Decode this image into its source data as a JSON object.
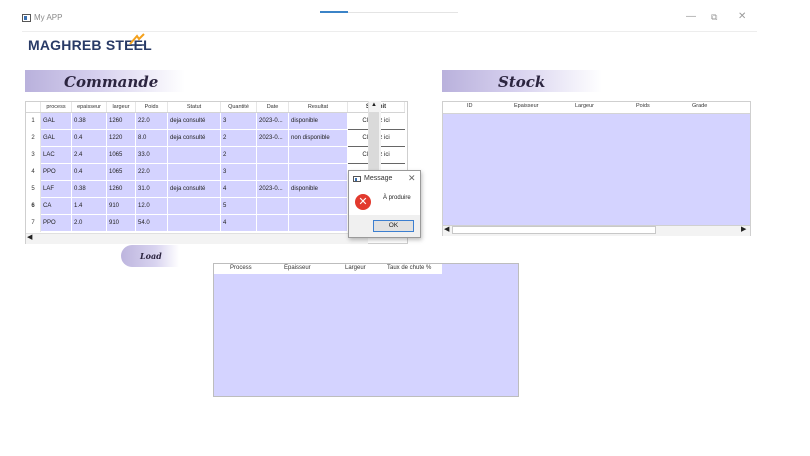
{
  "window": {
    "title": "My APP",
    "controls": {
      "minimize": "—",
      "restore": "⧉",
      "close": "✕"
    },
    "progress": 0.2
  },
  "logo": {
    "text": "MAGHREB STEEL",
    "colors": {
      "text": "#283a66",
      "accent": "#f4a11c"
    }
  },
  "commande": {
    "title": "Commande",
    "columns": [
      "process",
      "epaisseur",
      "largeur",
      "Poids",
      "Statut",
      "Quantité",
      "Date",
      "Resultat",
      "Submit"
    ],
    "rows": [
      {
        "num": "1",
        "process": "GAL",
        "epaisseur": "0.38",
        "largeur": "1260",
        "poids": "22.0",
        "statut": "deja consulté",
        "quantite": "3",
        "date": "2023-0...",
        "resultat": "disponible",
        "submit": "Cliquez ici"
      },
      {
        "num": "2",
        "process": "GAL",
        "epaisseur": "0.4",
        "largeur": "1220",
        "poids": "8.0",
        "statut": "deja consulté",
        "quantite": "2",
        "date": "2023-0...",
        "resultat": "non disponible",
        "submit": "Cliquez ici"
      },
      {
        "num": "3",
        "process": "LAC",
        "epaisseur": "2.4",
        "largeur": "1065",
        "poids": "33.0",
        "statut": "",
        "quantite": "2",
        "date": "",
        "resultat": "",
        "submit": "Cliquez ici"
      },
      {
        "num": "4",
        "process": "PPO",
        "epaisseur": "0.4",
        "largeur": "1065",
        "poids": "22.0",
        "statut": "",
        "quantite": "3",
        "date": "",
        "resultat": "",
        "submit": ""
      },
      {
        "num": "5",
        "process": "LAF",
        "epaisseur": "0.38",
        "largeur": "1260",
        "poids": "31.0",
        "statut": "deja consulté",
        "quantite": "4",
        "date": "2023-0...",
        "resultat": "disponible",
        "submit": ""
      },
      {
        "num": "6",
        "process": "CA",
        "epaisseur": "1.4",
        "largeur": "910",
        "poids": "12.0",
        "statut": "",
        "quantite": "5",
        "date": "",
        "resultat": "",
        "submit": ""
      },
      {
        "num": "7",
        "process": "PPO",
        "epaisseur": "2.0",
        "largeur": "910",
        "poids": "54.0",
        "statut": "",
        "quantite": "4",
        "date": "",
        "resultat": "",
        "submit": ""
      }
    ],
    "scroll": {
      "up": "▲",
      "left": "◀"
    }
  },
  "stock": {
    "title": "Stock",
    "columns": [
      "ID",
      "Epaisseur",
      "Largeur",
      "Poids",
      "Grade"
    ],
    "scroll": {
      "left": "◀",
      "right": "▶"
    }
  },
  "load_button": {
    "label": "Load"
  },
  "results": {
    "columns": [
      "Process",
      "Epaisseur",
      "Largeur",
      "Taux de chute %"
    ]
  },
  "message_dialog": {
    "title": "Message",
    "close": "✕",
    "error_icon": "✕",
    "text": "À produire",
    "ok_label": "OK"
  },
  "colors": {
    "table_fill": "#d4d3ff",
    "header_gradient": "#b9b1dc",
    "ok_border": "#3c7fd0",
    "error": "#e23a2e"
  }
}
